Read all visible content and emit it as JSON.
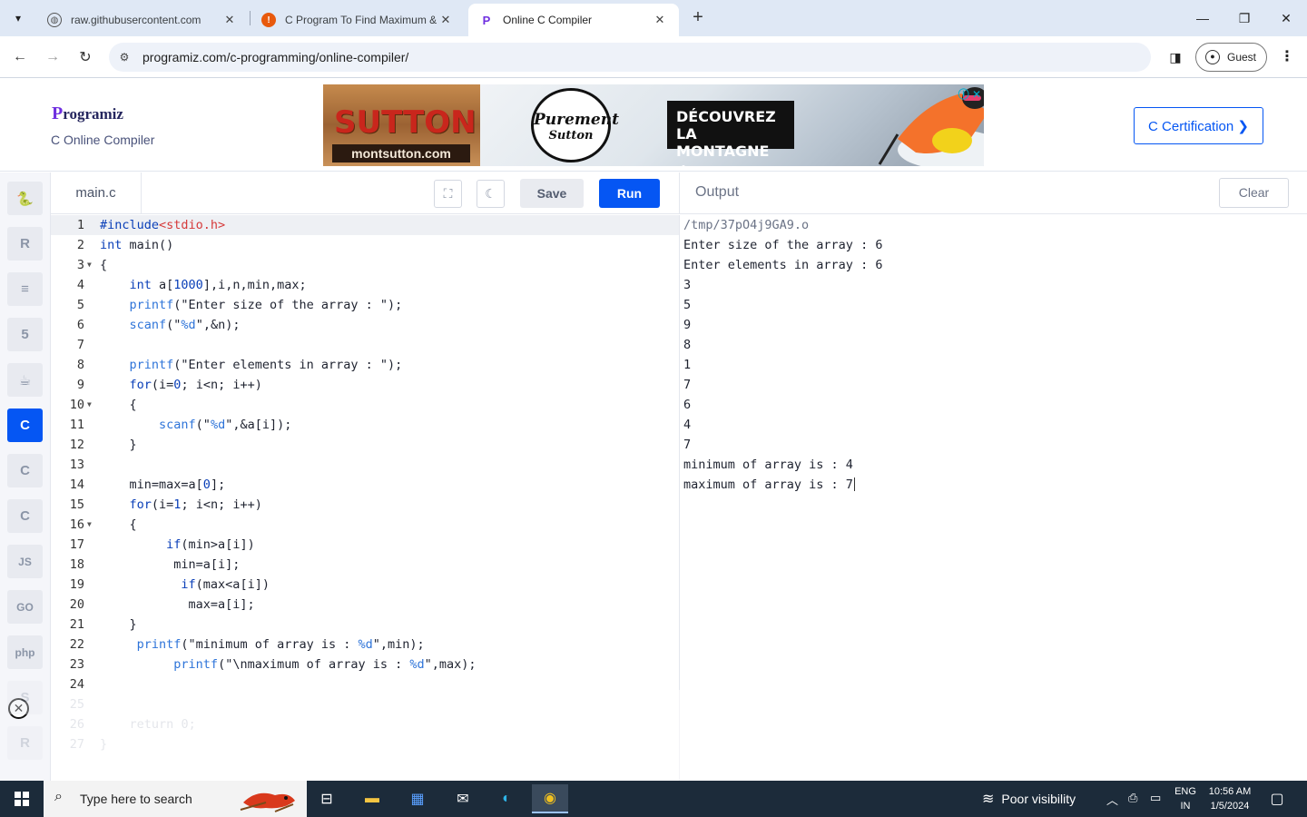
{
  "browser": {
    "tabs": [
      {
        "title": "raw.githubusercontent.com",
        "favicon": "globe-icon"
      },
      {
        "title": "C Program To Find Maximum &",
        "favicon": "firefox-like-icon"
      },
      {
        "title": "Online C Compiler",
        "favicon": "programiz-icon"
      }
    ],
    "url": "programiz.com/c-programming/online-compiler/",
    "profile_label": "Guest"
  },
  "site": {
    "logo": "rogramiz",
    "logo_initial": "P",
    "subtitle": "C Online Compiler",
    "certification_label": "C Certification ❯"
  },
  "ad": {
    "brand": "SUTTON",
    "website": "montsutton.com",
    "seal_line1": "Purement",
    "seal_line2": "Sutton",
    "headline_line1": "DÉCOUVREZ",
    "headline_line2": "LA MONTAGNE ➔"
  },
  "rail": {
    "languages": [
      {
        "name": "python",
        "glyph": "🐍"
      },
      {
        "name": "r",
        "glyph": "R"
      },
      {
        "name": "sql",
        "glyph": "≡"
      },
      {
        "name": "html",
        "glyph": "5"
      },
      {
        "name": "java",
        "glyph": "☕"
      },
      {
        "name": "c",
        "glyph": "C"
      },
      {
        "name": "cpp",
        "glyph": "C"
      },
      {
        "name": "csharp",
        "glyph": "C"
      },
      {
        "name": "js",
        "glyph": "JS"
      },
      {
        "name": "go",
        "glyph": "GO"
      },
      {
        "name": "php",
        "glyph": "php"
      },
      {
        "name": "swift",
        "glyph": "S"
      },
      {
        "name": "rust",
        "glyph": "R"
      }
    ],
    "active": "c"
  },
  "editor": {
    "filename": "main.c",
    "save_label": "Save",
    "run_label": "Run",
    "lines": [
      {
        "n": "1",
        "text": "#include<stdio.h>"
      },
      {
        "n": "2",
        "text": "int main()"
      },
      {
        "n": "3",
        "text": "{"
      },
      {
        "n": "4",
        "text": "    int a[1000],i,n,min,max;"
      },
      {
        "n": "5",
        "text": "    printf(\"Enter size of the array : \");"
      },
      {
        "n": "6",
        "text": "    scanf(\"%d\",&n);"
      },
      {
        "n": "7",
        "text": ""
      },
      {
        "n": "8",
        "text": "    printf(\"Enter elements in array : \");"
      },
      {
        "n": "9",
        "text": "    for(i=0; i<n; i++)"
      },
      {
        "n": "10",
        "text": "    {"
      },
      {
        "n": "11",
        "text": "        scanf(\"%d\",&a[i]);"
      },
      {
        "n": "12",
        "text": "    }"
      },
      {
        "n": "13",
        "text": ""
      },
      {
        "n": "14",
        "text": "    min=max=a[0];"
      },
      {
        "n": "15",
        "text": "    for(i=1; i<n; i++)"
      },
      {
        "n": "16",
        "text": "    {"
      },
      {
        "n": "17",
        "text": "         if(min>a[i])"
      },
      {
        "n": "18",
        "text": "          min=a[i];"
      },
      {
        "n": "19",
        "text": "           if(max<a[i])"
      },
      {
        "n": "20",
        "text": "            max=a[i];"
      },
      {
        "n": "21",
        "text": "    }"
      },
      {
        "n": "22",
        "text": "     printf(\"minimum of array is : %d\",min);"
      },
      {
        "n": "23",
        "text": "          printf(\"\\nmaximum of array is : %d\",max);"
      },
      {
        "n": "24",
        "text": ""
      },
      {
        "n": "25",
        "text": ""
      },
      {
        "n": "26",
        "text": "    return 0;"
      },
      {
        "n": "27",
        "text": "}"
      }
    ]
  },
  "output": {
    "title": "Output",
    "clear_label": "Clear",
    "lines": [
      "/tmp/37pO4j9GA9.o",
      "Enter size of the array : 6",
      "Enter elements in array : 6",
      "3",
      "5",
      "9",
      "8",
      "1",
      "7",
      "6",
      "4",
      "7",
      "minimum of array is : 4",
      "maximum of array is : 7"
    ]
  },
  "taskbar": {
    "search_placeholder": "Type here to search",
    "weather": "Poor visibility",
    "lang_line1": "ENG",
    "lang_line2": "IN",
    "time": "10:56 AM",
    "date": "1/5/2024"
  }
}
